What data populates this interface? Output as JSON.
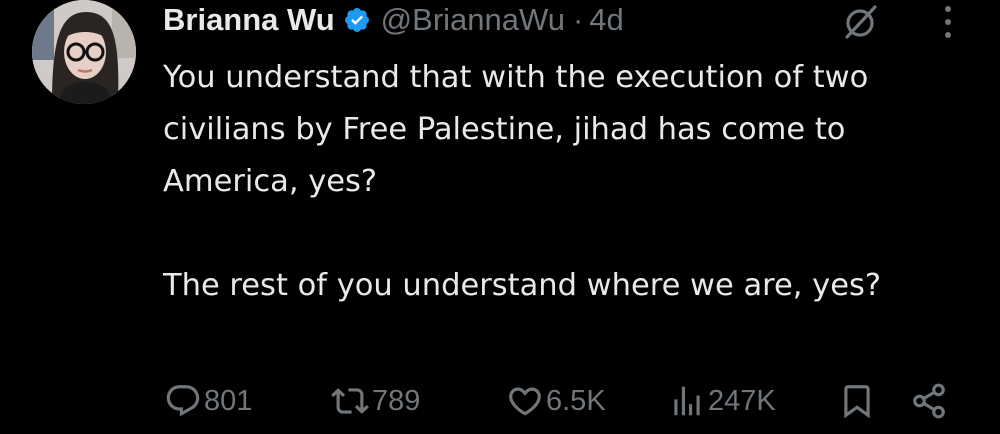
{
  "author": {
    "display_name": "Brianna Wu",
    "handle": "@BriannaWu",
    "separator": "·",
    "timestamp": "4d",
    "verified": true
  },
  "tweet": {
    "paragraph_1": "You understand that with the execution of two civilians by Free Palestine, jihad has come to America, yes?",
    "paragraph_2": "The rest of you understand where we are, yes?"
  },
  "actions": {
    "replies": "801",
    "reposts": "789",
    "likes": "6.5K",
    "views": "247K"
  },
  "icons": {
    "verified": "verified-badge-icon",
    "grok": "grok-icon",
    "more": "more-options-icon",
    "reply": "reply-icon",
    "repost": "repost-icon",
    "like": "heart-icon",
    "views": "views-icon",
    "bookmark": "bookmark-icon",
    "share": "share-icon"
  },
  "colors": {
    "background": "#000000",
    "text": "#e7e9ea",
    "muted": "#71767b",
    "verified": "#1d9bf0"
  }
}
